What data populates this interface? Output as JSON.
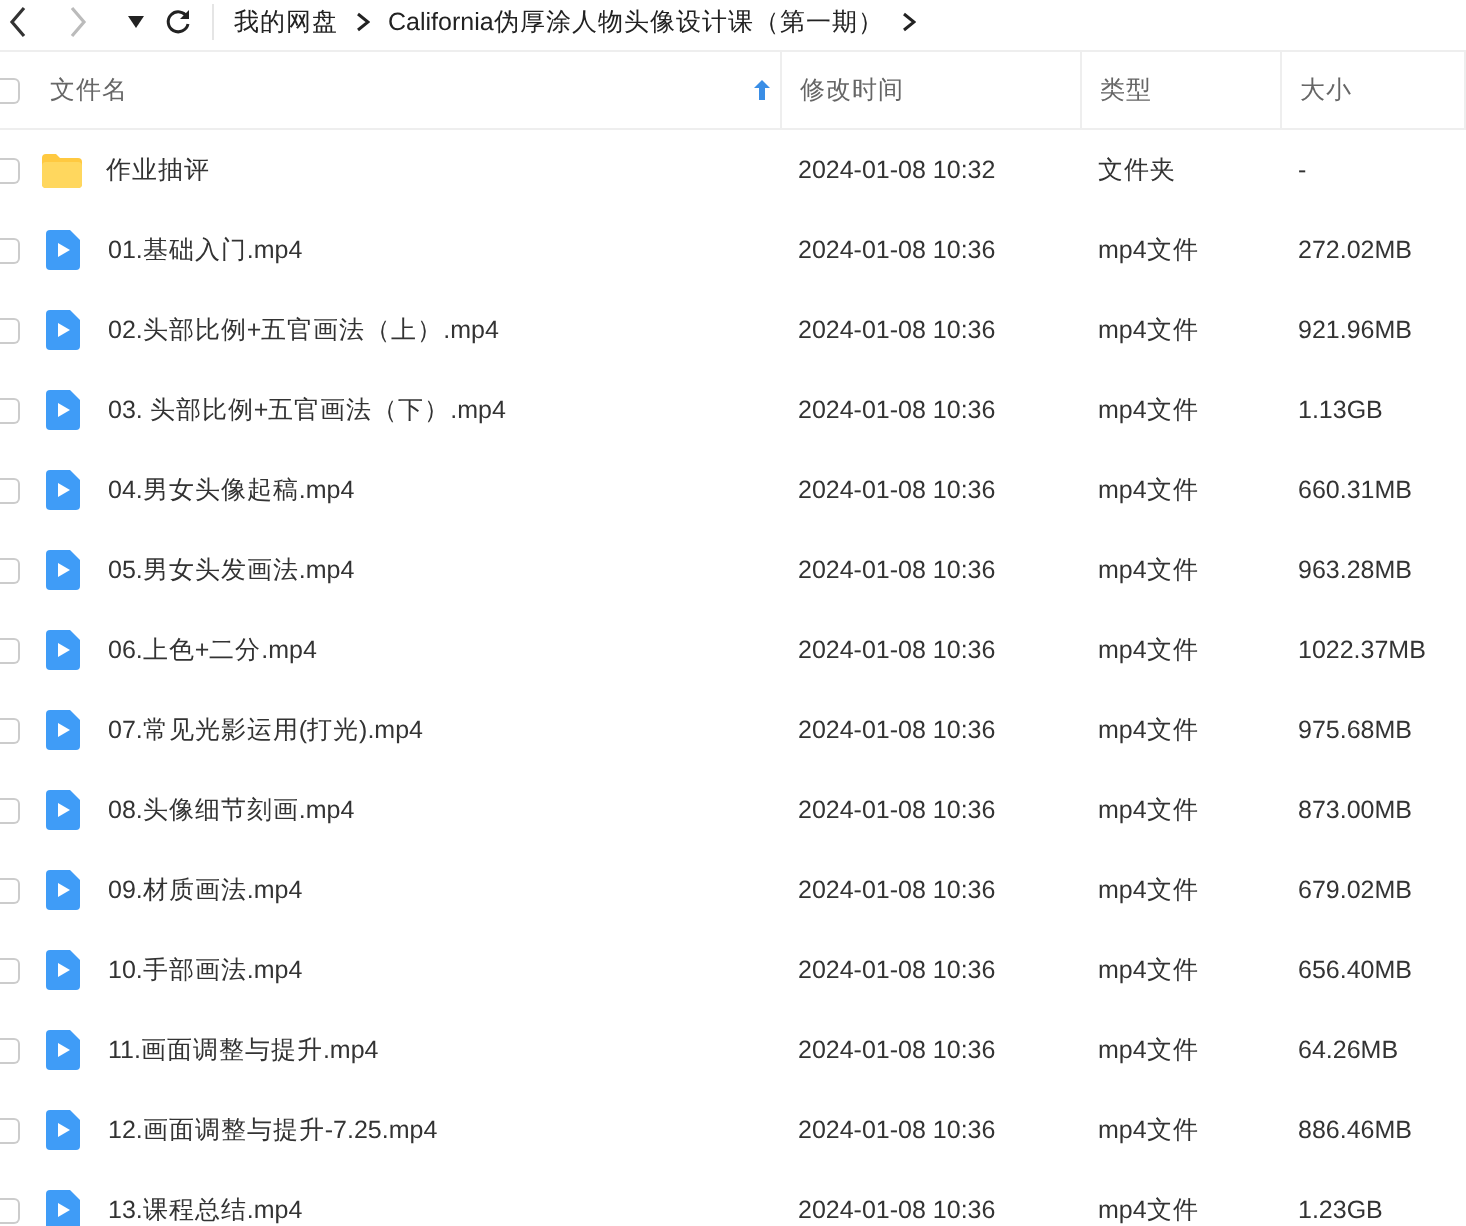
{
  "nav": {
    "back_disabled": false,
    "forward_disabled": true
  },
  "breadcrumb": [
    "我的网盘",
    "California伪厚涂人物头像设计课（第一期）"
  ],
  "table": {
    "all_checked": false,
    "columns": [
      "文件名",
      "修改时间",
      "类型",
      "大小"
    ],
    "rows": [
      {
        "kind": "folder",
        "checked": false,
        "name": "作业抽评",
        "modified": "2024-01-08 10:32",
        "type": "文件夹",
        "size": "-"
      },
      {
        "kind": "video",
        "checked": false,
        "name": "01.基础入门.mp4",
        "modified": "2024-01-08 10:36",
        "type": "mp4文件",
        "size": "272.02MB"
      },
      {
        "kind": "video",
        "checked": false,
        "name": "02.头部比例+五官画法（上）.mp4",
        "modified": "2024-01-08 10:36",
        "type": "mp4文件",
        "size": "921.96MB"
      },
      {
        "kind": "video",
        "checked": false,
        "name": "03. 头部比例+五官画法（下）.mp4",
        "modified": "2024-01-08 10:36",
        "type": "mp4文件",
        "size": "1.13GB"
      },
      {
        "kind": "video",
        "checked": false,
        "name": "04.男女头像起稿.mp4",
        "modified": "2024-01-08 10:36",
        "type": "mp4文件",
        "size": "660.31MB"
      },
      {
        "kind": "video",
        "checked": false,
        "name": "05.男女头发画法.mp4",
        "modified": "2024-01-08 10:36",
        "type": "mp4文件",
        "size": "963.28MB"
      },
      {
        "kind": "video",
        "checked": false,
        "name": "06.上色+二分.mp4",
        "modified": "2024-01-08 10:36",
        "type": "mp4文件",
        "size": "1022.37MB"
      },
      {
        "kind": "video",
        "checked": false,
        "name": "07.常见光影运用(打光).mp4",
        "modified": "2024-01-08 10:36",
        "type": "mp4文件",
        "size": "975.68MB"
      },
      {
        "kind": "video",
        "checked": false,
        "name": "08.头像细节刻画.mp4",
        "modified": "2024-01-08 10:36",
        "type": "mp4文件",
        "size": "873.00MB"
      },
      {
        "kind": "video",
        "checked": false,
        "name": "09.材质画法.mp4",
        "modified": "2024-01-08 10:36",
        "type": "mp4文件",
        "size": "679.02MB"
      },
      {
        "kind": "video",
        "checked": false,
        "name": "10.手部画法.mp4",
        "modified": "2024-01-08 10:36",
        "type": "mp4文件",
        "size": "656.40MB"
      },
      {
        "kind": "video",
        "checked": false,
        "name": "11.画面调整与提升.mp4",
        "modified": "2024-01-08 10:36",
        "type": "mp4文件",
        "size": "64.26MB"
      },
      {
        "kind": "video",
        "checked": false,
        "name": "12.画面调整与提升-7.25.mp4",
        "modified": "2024-01-08 10:36",
        "type": "mp4文件",
        "size": "886.46MB"
      },
      {
        "kind": "video",
        "checked": false,
        "name": "13.课程总结.mp4",
        "modified": "2024-01-08 10:36",
        "type": "mp4文件",
        "size": "1.23GB"
      }
    ]
  }
}
